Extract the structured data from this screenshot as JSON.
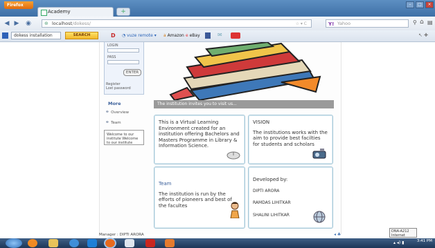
{
  "browser": {
    "app_button_label": "Firefox",
    "tab_title": "Academy",
    "new_tab_label": "+",
    "url_host": "localhost",
    "url_path": "/dokess/",
    "search_placeholder": "Yahoo",
    "toolbar": {
      "select_value": "dokess installation",
      "search_button_label": "SEARCH",
      "items": [
        "vuze remote",
        "Amazon",
        "eBay"
      ]
    }
  },
  "sidebar": {
    "login_label": "LOGIN",
    "pass_label": "PASS",
    "enter_label": "ENTER",
    "register_label": "Register",
    "lost_password_label": "Lost password",
    "more_title": "More",
    "links": [
      "Overview",
      "Team"
    ],
    "welcome_text": "Welcome to our institute Welcome to our institute"
  },
  "main": {
    "visit_banner": "The institution invites you to visit us...",
    "intro_card_text": "This is a Virtual Learning Environment created for an institution offering Bachelors and Masters Programme in Library & Information Science.",
    "vision_title": "VISION",
    "vision_text": "The institutions works with the aim to provide best facilties for students and scholars",
    "team_title": "Team",
    "team_text": "The institution is run by the efforts of pioneers and best of the facultes",
    "developed_by_label": "Developed by:",
    "developers": [
      "DIPTI ARORA",
      "RAMDAS LIHITKAR",
      "SHALINI LIHITKAR"
    ]
  },
  "footer": {
    "manager_label": "Manager : DIPTI ARORA"
  },
  "taskbar": {
    "tooltip_line1": "DNA-A212",
    "tooltip_line2": "Internet access",
    "time": "3:41 PM"
  },
  "colors": {
    "titlebar": "#4b7db5",
    "banner": "#9a9a9a",
    "card_border": "#a7c8d8",
    "link": "#3a5f9a"
  }
}
